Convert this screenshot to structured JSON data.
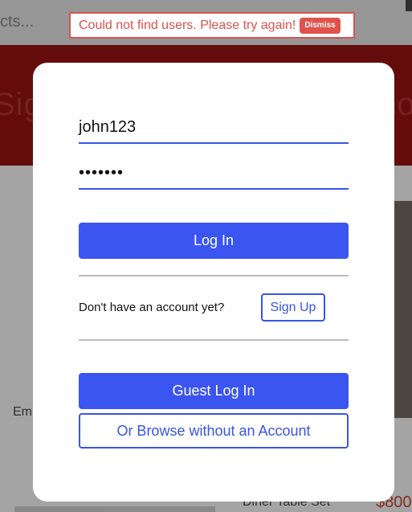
{
  "background": {
    "topbar_text": "cts...",
    "banner_text_left": "Sig",
    "banner_text_right": "no",
    "caption": "Em",
    "bottom_item_name": "Diner Table Set",
    "bottom_item_price": "$800"
  },
  "alert": {
    "message": "Could not find users. Please try again!",
    "dismiss_label": "Dismiss"
  },
  "login": {
    "username_value": "john123",
    "password_value": "•••••••",
    "login_button": "Log In",
    "signup_prompt": "Don't have an account yet?",
    "signup_button": "Sign Up",
    "guest_button": "Guest Log In",
    "browse_button": "Or Browse without an Account"
  },
  "colors": {
    "accent": "#3a55f0",
    "error": "#d9534f",
    "banner": "#7a0f0f"
  }
}
